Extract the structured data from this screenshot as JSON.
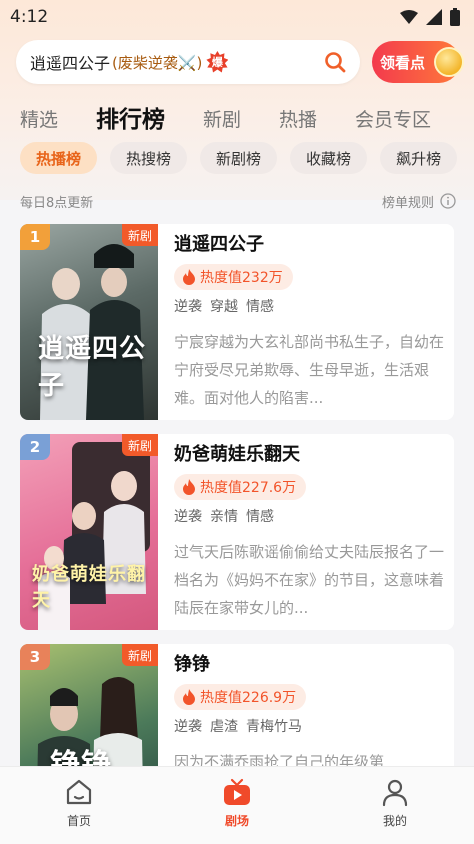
{
  "status_bar": {
    "time": "4:12"
  },
  "search": {
    "query": "逍遥四公子",
    "hint": "(废柴逆袭⚔️)",
    "hot_badge": "爆"
  },
  "coin_button": {
    "label": "领看点"
  },
  "main_tabs": [
    {
      "label": "精选",
      "active": false
    },
    {
      "label": "排行榜",
      "active": true
    },
    {
      "label": "新剧",
      "active": false
    },
    {
      "label": "热播",
      "active": false
    },
    {
      "label": "会员专区",
      "active": false
    }
  ],
  "sub_tabs": [
    {
      "label": "热播榜",
      "active": true
    },
    {
      "label": "热搜榜",
      "active": false
    },
    {
      "label": "新剧榜",
      "active": false
    },
    {
      "label": "收藏榜",
      "active": false
    },
    {
      "label": "飙升榜",
      "active": false
    }
  ],
  "info": {
    "update_text": "每日8点更新",
    "rules_label": "榜单规则"
  },
  "dramas": [
    {
      "rank": "1",
      "badge": "新剧",
      "poster_title": "逍遥四公子",
      "title": "逍遥四公子",
      "heat": "热度值232万",
      "tags": [
        "逆袭",
        "穿越",
        "情感"
      ],
      "desc": "宁宸穿越为大玄礼部尚书私生子，自幼在宁府受尽兄弟欺辱、生母早逝，生活艰难。面对他人的陷害..."
    },
    {
      "rank": "2",
      "badge": "新剧",
      "poster_title": "奶爸萌娃乐翻天",
      "title": "奶爸萌娃乐翻天",
      "heat": "热度值227.6万",
      "tags": [
        "逆袭",
        "亲情",
        "情感"
      ],
      "desc": "过气天后陈歌谣偷偷给丈夫陆辰报名了一档名为《妈妈不在家》的节目，这意味着陆辰在家带女儿的..."
    },
    {
      "rank": "3",
      "badge": "新剧",
      "poster_title": "铮铮",
      "title": "铮铮",
      "heat": "热度值226.9万",
      "tags": [
        "逆袭",
        "虐渣",
        "青梅竹马"
      ],
      "desc": "因为不满乔雨抢了自己的年级第"
    }
  ],
  "bottom_nav": [
    {
      "label": "首页",
      "icon": "home-icon",
      "active": false
    },
    {
      "label": "剧场",
      "icon": "theater-icon",
      "active": true
    },
    {
      "label": "我的",
      "icon": "profile-icon",
      "active": false
    }
  ],
  "colors": {
    "accent": "#f04a2a",
    "rank1": "#f2a03a",
    "rank2": "#7aa0d6",
    "rank3": "#e8825a"
  }
}
